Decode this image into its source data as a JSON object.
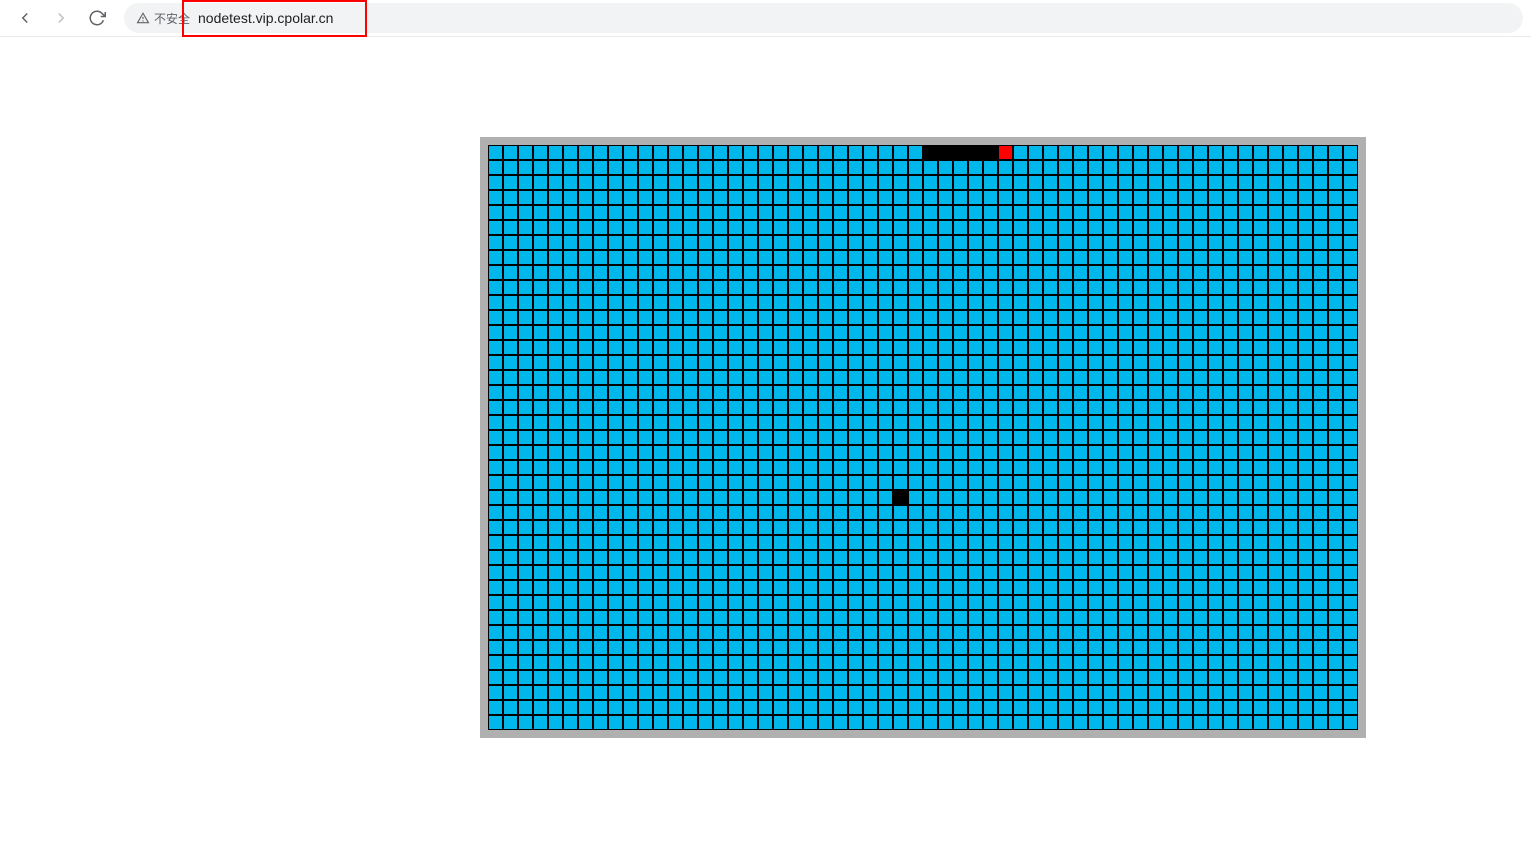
{
  "browser": {
    "security_label": "不安全",
    "url": "nodetest.vip.cpolar.cn"
  },
  "game": {
    "grid_cols": 58,
    "grid_rows": 39,
    "colors": {
      "board": "#00b7eb",
      "border": "#b0b0b0",
      "gridline": "#000000",
      "snake": "#000000",
      "snake_head": "#ff0000",
      "food": "#000000"
    },
    "snake_body": [
      {
        "row": 0,
        "col": 29
      },
      {
        "row": 0,
        "col": 30
      },
      {
        "row": 0,
        "col": 31
      },
      {
        "row": 0,
        "col": 32
      },
      {
        "row": 0,
        "col": 33
      }
    ],
    "snake_head": {
      "row": 0,
      "col": 34
    },
    "food": {
      "row": 23,
      "col": 27
    }
  }
}
